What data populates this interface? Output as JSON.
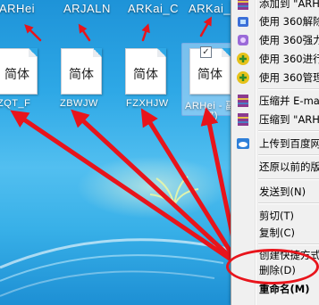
{
  "desktop": {
    "top_labels": [
      "ARHei",
      "ARJALN",
      "ARKai_C",
      "ARKai_"
    ],
    "files": [
      {
        "name": "ZQT_F",
        "glyphs": "简体"
      },
      {
        "name": "ZBWJW",
        "glyphs": "简体"
      },
      {
        "name": "FZXHJW",
        "glyphs": "简体"
      },
      {
        "name": "ARHei - 副",
        "glyphs": "简体",
        "subtitle": "(7)"
      }
    ],
    "selected_file_index": 3
  },
  "context_menu": {
    "items": [
      {
        "label": "添加到 \"ARH",
        "icon": "winrar-icon"
      },
      {
        "label": "使用 360解除",
        "icon": "360-unlock-icon"
      },
      {
        "label": "使用 360强力",
        "icon": "360-delete-icon"
      },
      {
        "label": "使用 360进行",
        "icon": "360-scan-icon"
      },
      {
        "label": "使用 360管理",
        "icon": "360-manage-icon"
      },
      {
        "label": "压缩并 E-ma",
        "icon": "winrar-icon"
      },
      {
        "label": "压缩到 \"ARH",
        "icon": "winrar-icon"
      },
      {
        "label": "上传到百度网",
        "icon": "baidu-cloud-icon"
      },
      {
        "label": "还原以前的版",
        "icon": ""
      },
      {
        "label": "发送到(N)",
        "icon": ""
      },
      {
        "label": "剪切(T)",
        "icon": ""
      },
      {
        "label": "复制(C)",
        "icon": ""
      },
      {
        "label": "创建快捷方式",
        "icon": ""
      },
      {
        "label": "删除(D)",
        "icon": ""
      },
      {
        "label": "重命名(M)",
        "icon": ""
      }
    ],
    "highlighted_label": "重命名(M)"
  },
  "colors": {
    "desktop": "#2ea8e6",
    "annotation": "#e8141b",
    "menu_bg": "#f0f0f0"
  }
}
